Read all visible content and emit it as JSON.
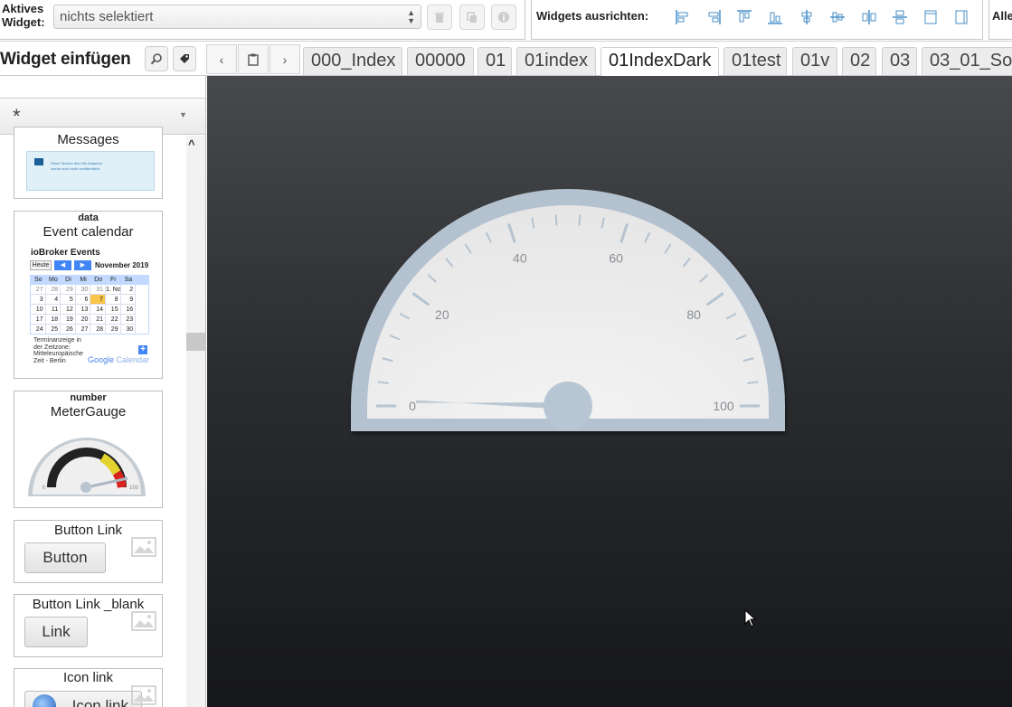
{
  "toolbar": {
    "active_label_1": "Aktives",
    "active_label_2": "Widget:",
    "select_value": "nichts selektiert",
    "align_label": "Widgets ausrichten:",
    "alle_label": "Alle"
  },
  "insert": {
    "title": "Widget einfügen"
  },
  "tabs": [
    "000_Index",
    "00000",
    "01",
    "01index",
    "01IndexDark",
    "01test",
    "01v",
    "02",
    "03",
    "03_01_So"
  ],
  "active_tab": "01IndexDark",
  "filter": {
    "value": "*"
  },
  "widgets": {
    "messages": {
      "name": "Messages",
      "preview_line1": "Diese Version des Info Adapters",
      "preview_line2": "wurde noch nicht veröffentlicht."
    },
    "calendar": {
      "type": "data",
      "name": "Event calendar",
      "header": "ioBroker Events",
      "today": "Heute",
      "month": "November 2019",
      "weekdays": [
        "So",
        "Mo",
        "Di",
        "Mi",
        "Do",
        "Fr",
        "Sa"
      ],
      "weeks": [
        [
          "27",
          "28",
          "29",
          "30",
          "31",
          "1. No",
          "2"
        ],
        [
          "3",
          "4",
          "5",
          "6",
          "7",
          "8",
          "9"
        ],
        [
          "10",
          "11",
          "12",
          "13",
          "14",
          "15",
          "16"
        ],
        [
          "17",
          "18",
          "19",
          "20",
          "21",
          "22",
          "23"
        ],
        [
          "24",
          "25",
          "26",
          "27",
          "28",
          "29",
          "30"
        ]
      ],
      "tz_1": "Terminanzeige in",
      "tz_2": "der Zeitzone:",
      "tz_3": "Mitteleuropäische",
      "tz_4": "Zeit - Berlin",
      "google": "Google",
      "cal": "Calendar"
    },
    "meter": {
      "type": "number",
      "name": "MeterGauge",
      "min": "0",
      "max": "100"
    },
    "button_link": {
      "name": "Button Link",
      "button": "Button"
    },
    "button_blank": {
      "name": "Button Link _blank",
      "button": "Link"
    },
    "icon_link": {
      "name": "Icon link",
      "button": "Icon link"
    }
  },
  "gauge": {
    "min": 0,
    "max": 100,
    "value": 1,
    "labels": [
      "0",
      "20",
      "40",
      "60",
      "80",
      "100"
    ],
    "colors": {
      "rim": "#b4c2d0",
      "face": "#eeeeee",
      "needle": "#b8c6d3",
      "text": "#8a8f94"
    }
  },
  "colors": {
    "accent": "#4285f4",
    "today": "#f7c548"
  }
}
